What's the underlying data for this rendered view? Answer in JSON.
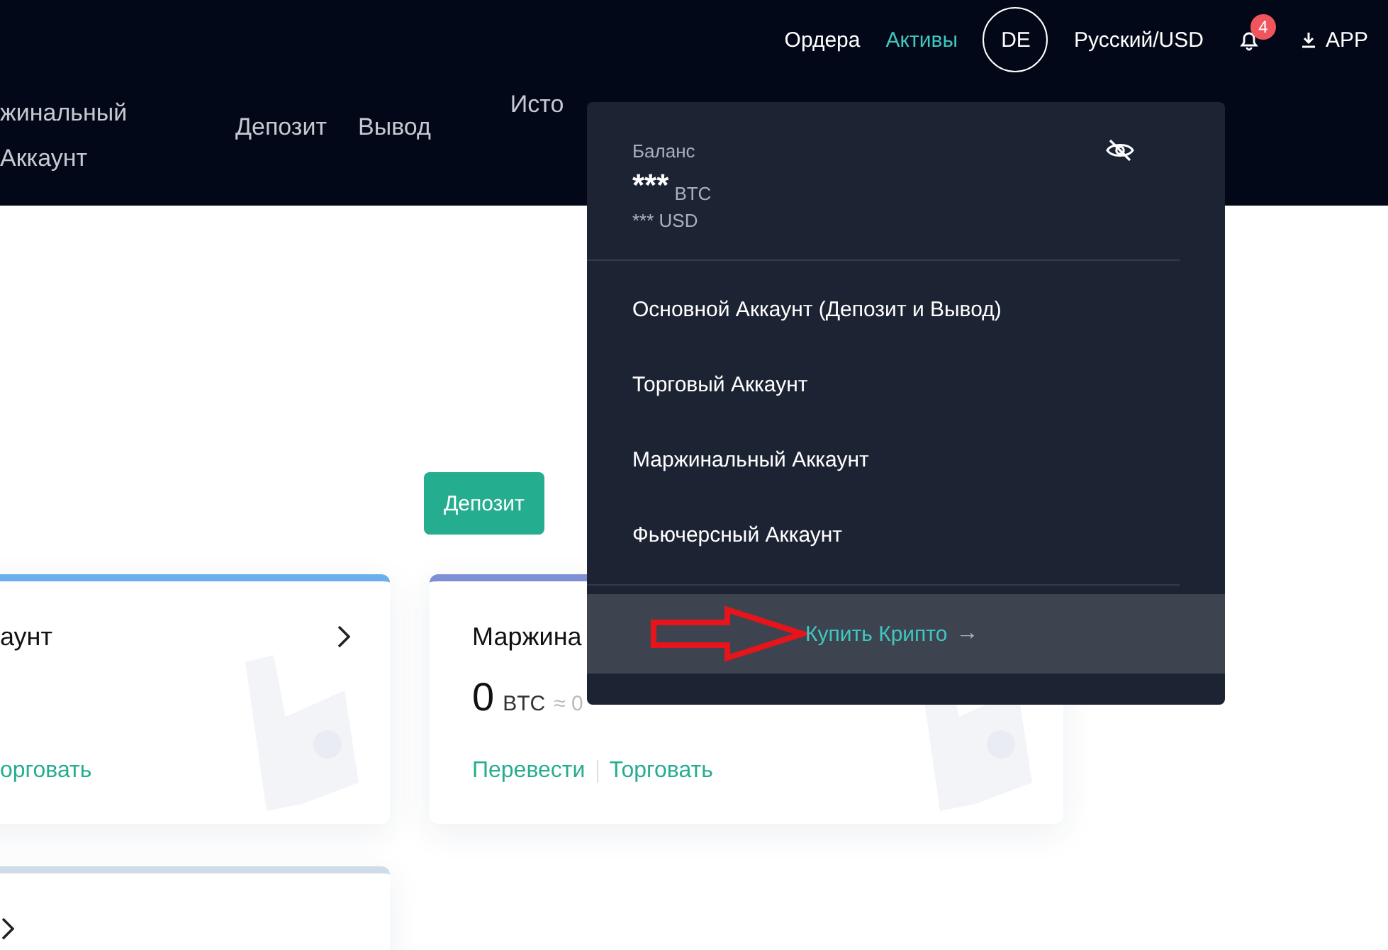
{
  "top_nav": {
    "links": [
      {
        "label": "Ордера",
        "selected": false
      },
      {
        "label": "Активы",
        "selected": true
      }
    ],
    "avatar": "DE",
    "language": "Русский/USD",
    "notifications": "4",
    "app": "APP"
  },
  "sub_nav": {
    "account_lines": [
      "жинальный",
      "Аккаунт"
    ],
    "links": [
      "Депозит",
      "Вывод",
      "Исто"
    ]
  },
  "deposit_button": "Депозит",
  "cards": [
    {
      "title": "аунт",
      "color": "#6aaef0",
      "links": [
        "орговать"
      ]
    },
    {
      "title": "Маржина",
      "color": "#7f8fd6",
      "amount": "0",
      "unit": "BTC",
      "approx": "≈ 0",
      "links": [
        "Перевести",
        "Торговать"
      ]
    },
    {
      "color": "#cfdbe6"
    }
  ],
  "dropdown": {
    "balance_label": "Баланс",
    "balance_value": "***",
    "balance_unit": "BTC",
    "balance_usd": "*** USD",
    "accounts": [
      "Основной Аккаунт (Депозит и Вывод)",
      "Торговый Аккаунт",
      "Маржинальный Аккаунт",
      "Фьючерсный Аккаунт"
    ],
    "buy_link": "Купить Крипто",
    "buy_arrow": "→"
  }
}
